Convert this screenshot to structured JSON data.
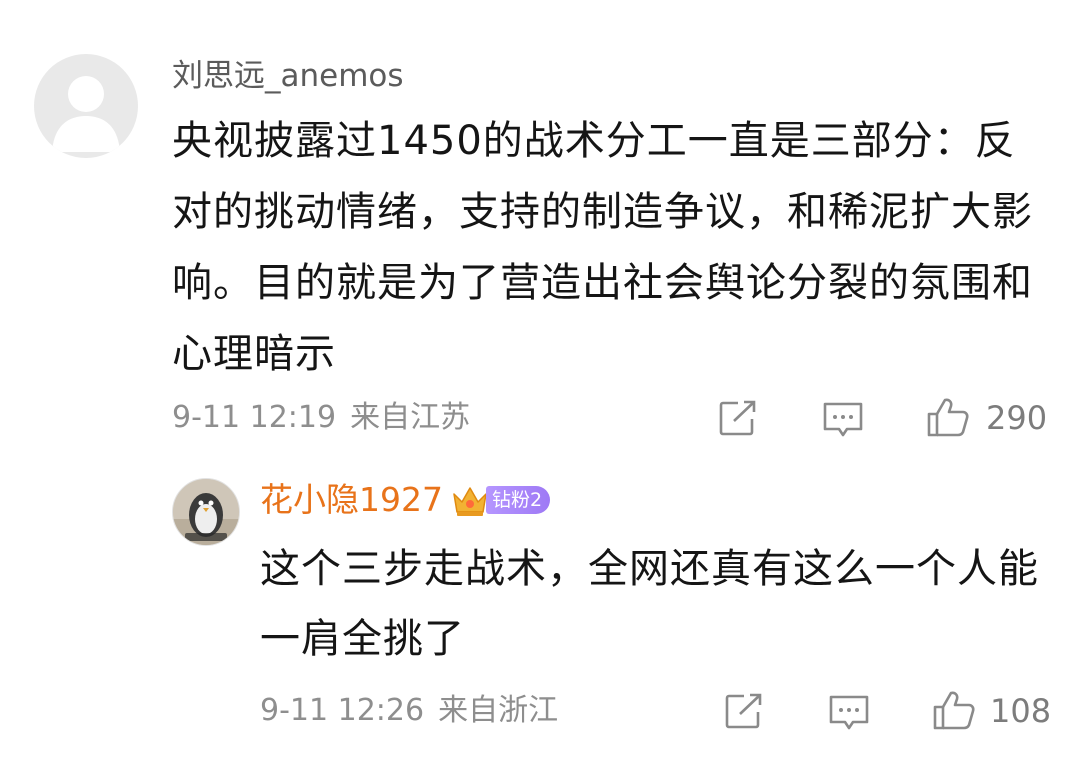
{
  "comment": {
    "username": "刘思远_anemos",
    "text": "央视披露过1450的战术分工一直是三部分：反对的挑动情绪，支持的制造争议，和稀泥扩大影响。目的就是为了营造出社会舆论分裂的氛围和心理暗示",
    "time": "9-11 12:19",
    "location": "来自江苏",
    "likes": "290",
    "icons": [
      "share-icon",
      "comment-icon",
      "like-icon"
    ]
  },
  "reply": {
    "username": "花小隐1927",
    "username_color": "#e8731a",
    "fan_badge": "钻粉2",
    "text": "这个三步走战术，全网还真有这么一个人能一肩全挑了",
    "time": "9-11 12:26",
    "location": "来自浙江",
    "likes": "108",
    "icons": [
      "share-icon",
      "comment-icon",
      "like-icon"
    ]
  }
}
